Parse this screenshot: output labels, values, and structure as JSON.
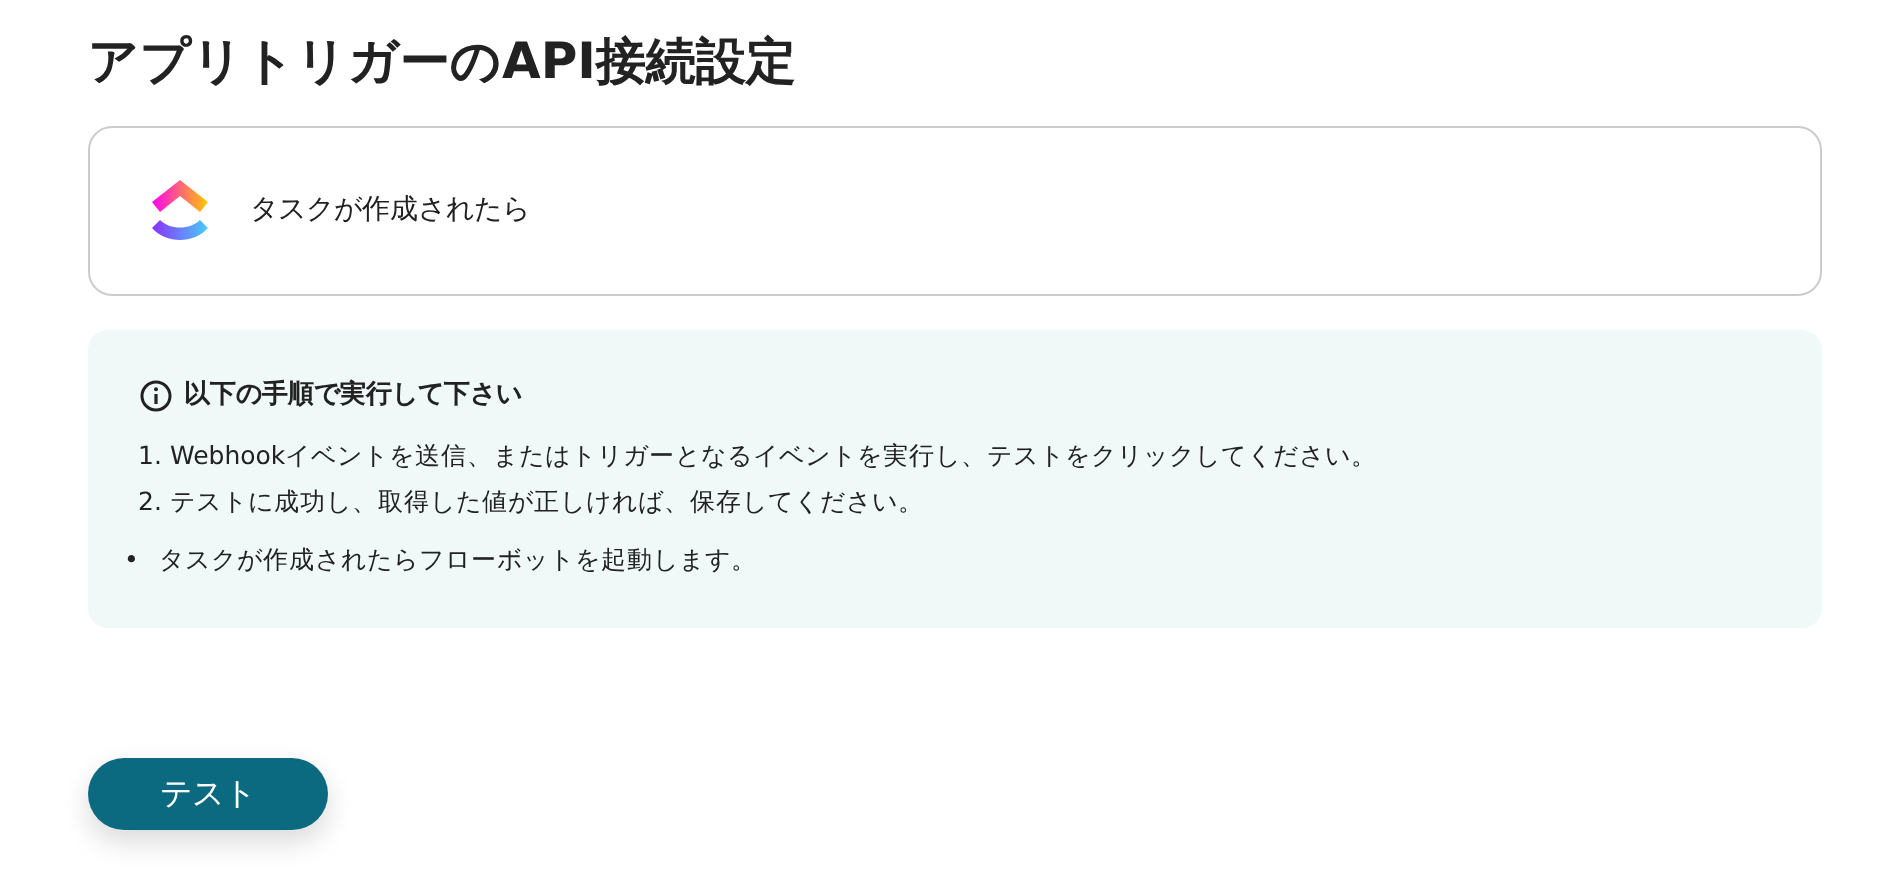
{
  "title": "アプリトリガーのAPI接続設定",
  "trigger": {
    "label": "タスクが作成されたら"
  },
  "instructions": {
    "heading": "以下の手順で実行して下さい",
    "steps": [
      {
        "number": "1.",
        "text": "Webhookイベントを送信、またはトリガーとなるイベントを実行し、テストをクリックしてください。"
      },
      {
        "number": "2.",
        "text": "テストに成功し、取得した値が正しければ、保存してください。"
      }
    ],
    "notes": [
      {
        "bullet": "•",
        "text": "タスクが作成されたらフローボットを起動します。"
      }
    ]
  },
  "button": {
    "label": "テスト"
  }
}
